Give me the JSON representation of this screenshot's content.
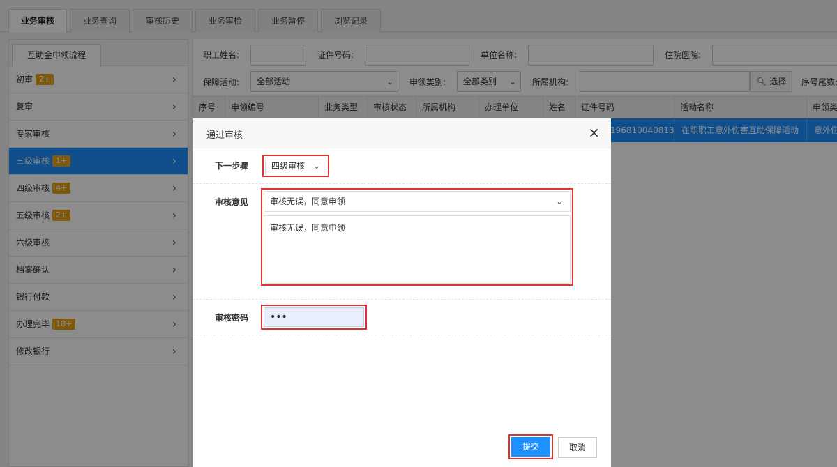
{
  "top_tabs": [
    "业务审核",
    "业务查询",
    "审核历史",
    "业务审检",
    "业务暂停",
    "浏览记录"
  ],
  "sidebar": {
    "tab_label": "互助金申领流程",
    "items": [
      {
        "label": "初审",
        "badge": "2+"
      },
      {
        "label": "复审",
        "badge": ""
      },
      {
        "label": "专家审核",
        "badge": ""
      },
      {
        "label": "三级审核",
        "badge": "1+"
      },
      {
        "label": "四级审核",
        "badge": "4+"
      },
      {
        "label": "五级审核",
        "badge": "2+"
      },
      {
        "label": "六级审核",
        "badge": ""
      },
      {
        "label": "档案确认",
        "badge": ""
      },
      {
        "label": "银行付款",
        "badge": ""
      },
      {
        "label": "办理完毕",
        "badge": "18+"
      },
      {
        "label": "修改银行",
        "badge": ""
      }
    ]
  },
  "filters": {
    "employee_name_label": "职工姓名:",
    "id_number_label": "证件号码:",
    "unit_name_label": "单位名称:",
    "hospital_label": "住院医院:",
    "activity_label": "保障活动:",
    "activity_value": "全部活动",
    "claim_type_label": "申领类别:",
    "claim_type_value": "全部类别",
    "org_label": "所属机构:",
    "choose_button": "选择",
    "serial_tail_label": "序号尾数:"
  },
  "table": {
    "headers": [
      "序号",
      "申领编号",
      "业务类型",
      "审核状态",
      "所属机构",
      "办理单位",
      "姓名",
      "证件号码",
      "活动名称",
      "申领类"
    ],
    "row": {
      "id_number": "196810040813",
      "activity_name": "在职职工意外伤害互助保障活动",
      "claim_type": "意外伤"
    }
  },
  "modal": {
    "title": "通过审核",
    "next_step_label": "下一步骤",
    "next_step_value": "四级审核",
    "opinion_label": "审核意见",
    "opinion_select_value": "审核无误，同意申领",
    "opinion_text": "审核无误，同意申领",
    "password_label": "审核密码",
    "password_value": "•••",
    "submit_label": "提交",
    "cancel_label": "取消"
  },
  "colors": {
    "accent": "#1e90ff",
    "badge": "#e8a21a",
    "highlight_border": "#e03232"
  }
}
